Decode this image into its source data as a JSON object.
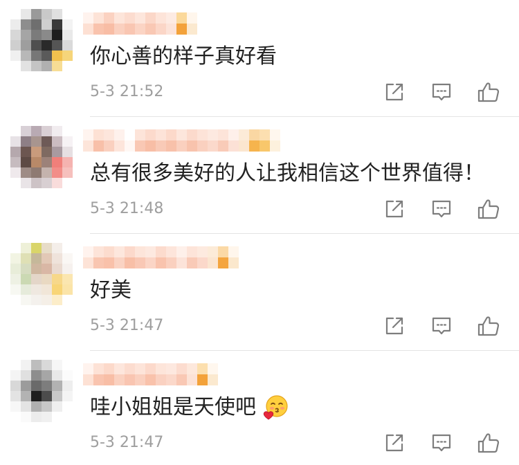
{
  "comments": [
    {
      "avatar_mosaic": [
        [
          "#ffffff",
          "#e8e8e8",
          "#9a9a9a",
          "#c9c9c9",
          "#e0e0e0",
          "#ffffff"
        ],
        [
          "#ececec",
          "#8d8d8d",
          "#6f6f6f",
          "#cfcfcf",
          "#3a3a3a",
          "#f3f3f3"
        ],
        [
          "#d7d7d7",
          "#a5a5a5",
          "#7b7b7b",
          "#8a8a8a",
          "#1d1d1d",
          "#e9e9e9"
        ],
        [
          "#cfcfcf",
          "#9e9e9e",
          "#4f4f4f",
          "#2a2a2a",
          "#555555",
          "#dadada"
        ],
        [
          "#f0f0f0",
          "#b8b8b8",
          "#777777",
          "#5a5a5a",
          "#f2c14e",
          "#f6d57a"
        ],
        [
          "#ffffff",
          "#e2e2e2",
          "#c4c4c4",
          "#b0b0b0",
          "#f7dd95",
          "#ffffff"
        ]
      ],
      "username_mosaic": [
        [
          "#fff3ee",
          "#fde3d7",
          "#fbd2c1",
          "#fde5da",
          "#fcdccf",
          "#fde6dc",
          "#fbd7c8",
          "#fde4d9",
          "#fdebe3",
          "#fbd99b",
          "#fff6ec"
        ],
        [
          "#fde0d3",
          "#f9c3ad",
          "#f8bda5",
          "#fad0bf",
          "#f9c6b2",
          "#fbd4c4",
          "#f9c8b4",
          "#fbd6c7",
          "#fce3d9",
          "#f3a23a",
          "#fbe9cf"
        ]
      ],
      "text": "你心善的样子真好看",
      "time": "5-3 21:52"
    },
    {
      "avatar_mosaic": [
        [
          "#ffffff",
          "#d8d0d6",
          "#b9aab3",
          "#d9cfd4",
          "#f1ecef",
          "#ffffff"
        ],
        [
          "#e7e2e6",
          "#8e7f86",
          "#a8958f",
          "#6e5a57",
          "#cbbcc1",
          "#f6f2f4"
        ],
        [
          "#b5a8ad",
          "#6c5650",
          "#c99b7c",
          "#7f6a61",
          "#a99aa0",
          "#e6dfe2"
        ],
        [
          "#c6bbbf",
          "#5d4a44",
          "#b88968",
          "#9c8279",
          "#f07f7a",
          "#f5b3b0"
        ],
        [
          "#efe9ec",
          "#9e8c86",
          "#8e7a72",
          "#c4b3ad",
          "#f28d88",
          "#f6c0bd"
        ],
        [
          "#ffffff",
          "#e9e4e7",
          "#cdc3c6",
          "#d8cfd2",
          "#f9dcdb",
          "#ffffff"
        ]
      ],
      "username_mosaic": [
        [
          "#fff4ef",
          "#fde1d4",
          "#fde6dc",
          "#fef1ec",
          "#ffffff",
          "#fde4d9",
          "#fcdacc",
          "#fde3d8",
          "#fcd9ca",
          "#fde6dc",
          "#fcdacc",
          "#fde3d8",
          "#fde9e0",
          "#fde4d9",
          "#fef0ea",
          "#fcebd8",
          "#fad7a3",
          "#fcdfb0",
          "#fff7ee"
        ],
        [
          "#fde5da",
          "#f8c0a9",
          "#fad0bf",
          "#fde5db",
          "#fff7f4",
          "#f9c8b4",
          "#f8bea6",
          "#f9cab7",
          "#f8c1aa",
          "#fad0bf",
          "#f8c3ad",
          "#fad0bf",
          "#fbd9cb",
          "#f9cbb8",
          "#fce1d6",
          "#fbe6cf",
          "#f6b44d",
          "#f8c76b",
          "#fdf1dd"
        ]
      ],
      "text": "总有很多美好的人让我相信这个世界值得！",
      "time": "5-3 21:48"
    },
    {
      "avatar_mosaic": [
        [
          "#ffffff",
          "#eef0d8",
          "#d9d56a",
          "#e7dcc8",
          "#f4eee9",
          "#ffffff"
        ],
        [
          "#f2f4e3",
          "#dfe0b5",
          "#c5b89a",
          "#e2c8b6",
          "#efe3db",
          "#faf7f4"
        ],
        [
          "#e8edd9",
          "#d6dcc0",
          "#cfb7a0",
          "#d9b7a5",
          "#eadad0",
          "#f6f1ee"
        ],
        [
          "#eef1e4",
          "#cbd9b3",
          "#e4d6c9",
          "#e9d9c2",
          "#f7d88a",
          "#fbe6b0"
        ],
        [
          "#f7f8f2",
          "#e6ebdb",
          "#efe8e0",
          "#f1e6d8",
          "#f8d577",
          "#fbe4a8"
        ],
        [
          "#ffffff",
          "#f7f7f2",
          "#f4f1ed",
          "#f5efe7",
          "#fcedc9",
          "#ffffff"
        ]
      ],
      "username_mosaic": [
        [
          "#fff3ee",
          "#fde4d9",
          "#fcdcce",
          "#fde7dd",
          "#fcd9cb",
          "#fde5da",
          "#fde9e0",
          "#fcdbcd",
          "#fde5db",
          "#fef0ea",
          "#fde4d9",
          "#fdeadf",
          "#fcebd8",
          "#fbd9a6",
          "#fff6ec"
        ],
        [
          "#fde3d7",
          "#f9c6b1",
          "#f9c1aa",
          "#fad3c3",
          "#f8bfa7",
          "#f9c8b5",
          "#fbd5c6",
          "#f9c3ad",
          "#fad0bf",
          "#fce3d9",
          "#f9cab7",
          "#fbd8ca",
          "#fbe5d0",
          "#f4a53f",
          "#fbe8cd"
        ]
      ],
      "text": "好美",
      "time": "5-3 21:47"
    },
    {
      "avatar_mosaic": [
        [
          "#ffffff",
          "#f2f2f2",
          "#bdbdbd",
          "#d9d9d9",
          "#f6f6f6",
          "#ffffff"
        ],
        [
          "#f4f4f4",
          "#e0e0e0",
          "#8e8e8e",
          "#a6a6a6",
          "#e8e8e8",
          "#fbfbfb"
        ],
        [
          "#d8d8d8",
          "#9b9b9b",
          "#6a6a6a",
          "#7d7d7d",
          "#b2b2b2",
          "#eeeeee"
        ],
        [
          "#e3e3e3",
          "#b3b3b3",
          "#1e1e1e",
          "#4c4c4c",
          "#c8c8c8",
          "#f4f4f4"
        ],
        [
          "#f7f7f7",
          "#e4e4e4",
          "#b0b0b0",
          "#c7c7c7",
          "#efefef",
          "#ffffff"
        ],
        [
          "#ffffff",
          "#fafafa",
          "#ececec",
          "#f0f0f0",
          "#ffffff",
          "#ffffff"
        ]
      ],
      "username_mosaic": [
        [
          "#fff3ee",
          "#fde2d6",
          "#fcd9ca",
          "#fde6dc",
          "#fcdccf",
          "#fde4d9",
          "#fcd9cb",
          "#fde5da",
          "#fde8df",
          "#fcdccf",
          "#fde8dc",
          "#fcdfae",
          "#fff7ee"
        ],
        [
          "#fde1d4",
          "#f9c4af",
          "#f8bea6",
          "#fad1c0",
          "#f9c5b1",
          "#fad0bf",
          "#f9c2ab",
          "#fad1c1",
          "#fbd8ca",
          "#f9c8b4",
          "#fce2d6",
          "#f3a23a",
          "#fbe9cf"
        ]
      ],
      "text": "哇小姐姐是天使吧",
      "emoji": "heart-face-emoji-icon",
      "time": "5-3 21:47"
    }
  ],
  "action_icons": {
    "forward": "forward-icon",
    "comment": "comment-icon",
    "like": "like-icon"
  },
  "colors": {
    "text": "#222222",
    "meta": "#9e9e9e",
    "icon": "#7d7d7d",
    "divider": "#e4e4e4",
    "background": "#ffffff"
  }
}
